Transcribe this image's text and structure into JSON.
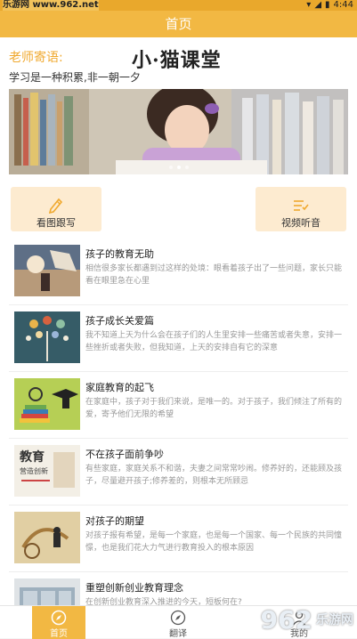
{
  "status": {
    "watermark": "乐游网 www.962.net",
    "time": "4:44"
  },
  "titlebar": {
    "title": "首页"
  },
  "header": {
    "motto_label": "老师寄语:",
    "brand": "小·猫课堂",
    "motto_text": "学习是一种积累,非一朝一夕"
  },
  "banner": {
    "page_count": 3,
    "active_page": 1
  },
  "quick_actions": [
    {
      "label": "看图跟写",
      "icon": "pencil-icon"
    },
    {
      "label": "视频听音",
      "icon": "checklist-icon"
    }
  ],
  "articles": [
    {
      "title": "孩子的教育无助",
      "desc": "相信很多家长都遇到过这样的处境：眼看着孩子出了一些问题，家长只能看在眼里急在心里"
    },
    {
      "title": "孩子成长关爱篇",
      "desc": "我不知道上天为什么会在孩子们的人生里安排一些痛苦或者失意，安排一些挫折或者失败，但我知道，上天的安排自有它的深意"
    },
    {
      "title": "家庭教育的起飞",
      "desc": "在家庭中，孩子对于我们来说，是唯一的。对于孩子，我们倾注了所有的爱，寄予他们无限的希望"
    },
    {
      "title": "不在孩子面前争吵",
      "desc": "有些家庭，家庭关系不和谐，夫妻之间常常吵闹。修养好的，还能顾及孩子，尽量避开孩子;修养差的，则根本无所顾忌"
    },
    {
      "title": "对孩子的期望",
      "desc": "对孩子报有希望，是每一个家庭，也是每一个国家、每一个民族的共同憧憬，也是我们花大力气进行教育投入的根本原因"
    },
    {
      "title": "重塑创新创业教育理念",
      "desc": "在创新创业教育深入推进的今天，短板何在?"
    }
  ],
  "tabs": [
    {
      "label": "首页",
      "icon": "compass-icon",
      "active": true
    },
    {
      "label": "翻译",
      "icon": "compass-icon",
      "active": false
    },
    {
      "label": "我的",
      "icon": "user-icon",
      "active": false
    }
  ],
  "thumb_texts": {
    "book_title": "教育",
    "book_sub": "营造创新"
  },
  "overlay_watermark": {
    "number": "962",
    "text": "乐游网"
  },
  "colors": {
    "accent": "#f2b843",
    "motto": "#f0a92f",
    "quick_bg": "#fdebd0"
  }
}
